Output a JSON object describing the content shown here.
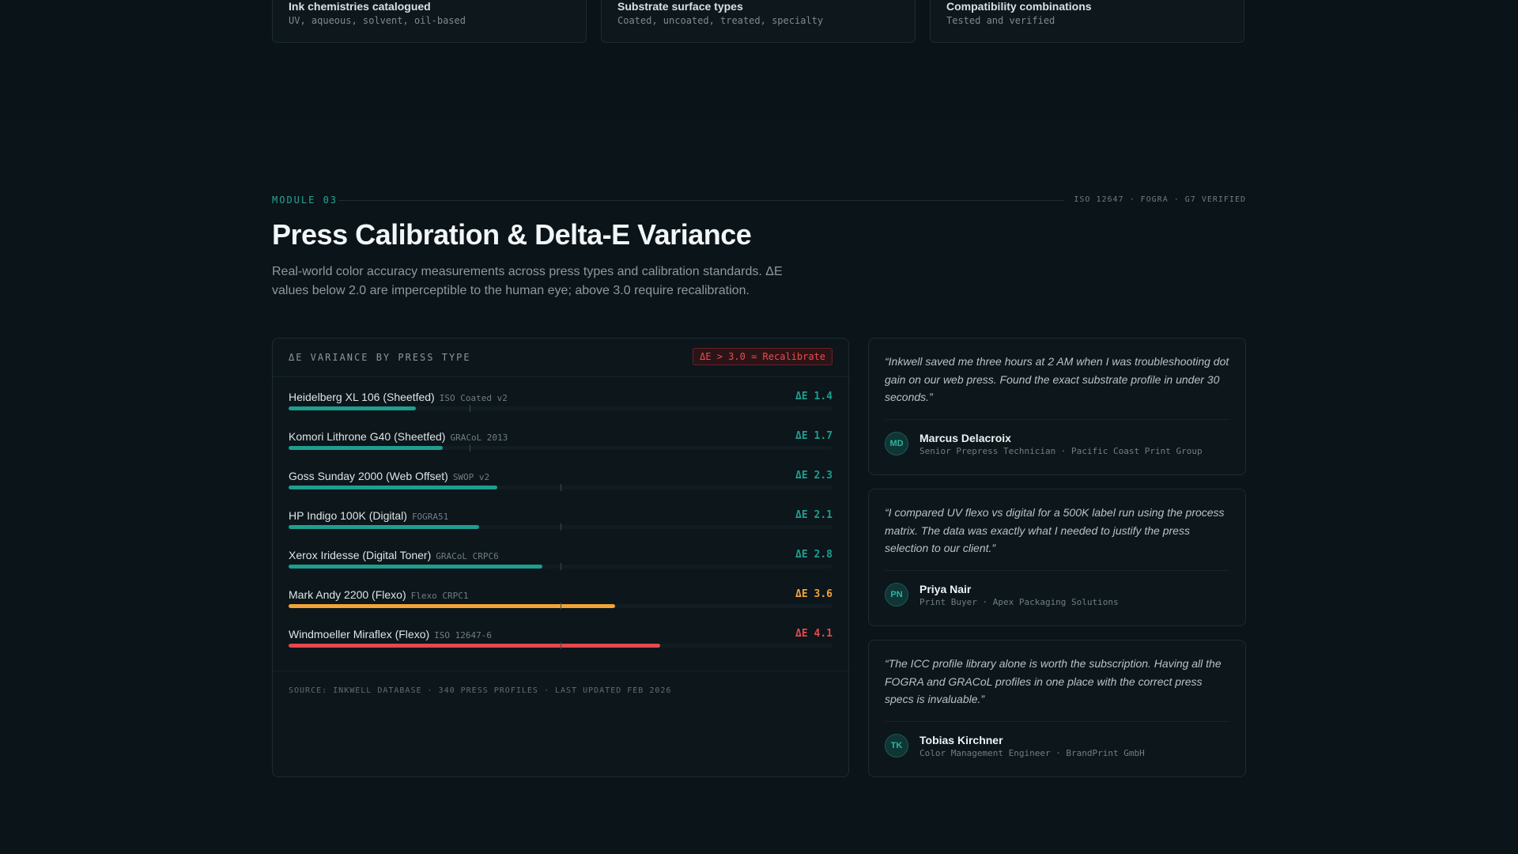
{
  "stats": [
    {
      "label": "Ink chemistries catalogued",
      "sub": "UV, aqueous, solvent, oil-based"
    },
    {
      "label": "Substrate surface types",
      "sub": "Coated, uncoated, treated, specialty"
    },
    {
      "label": "Compatibility combinations",
      "sub": "Tested and verified"
    }
  ],
  "module": {
    "label": "MODULE 03",
    "meta": "ISO 12647 · FOGRA · G7 VERIFIED",
    "title": "Press Calibration & Delta-E Variance",
    "description": "Real-world color accuracy measurements across press types and calibration standards. ΔE values below 2.0 are imperceptible to the human eye; above 3.0 require recalibration."
  },
  "chart": {
    "title": "ΔE VARIANCE BY PRESS TYPE",
    "badge": "ΔE > 3.0 = Recalibrate",
    "source": "SOURCE: INKWELL DATABASE · 340 PRESS PROFILES · LAST UPDATED FEB 2026"
  },
  "chart_data": {
    "type": "bar",
    "orientation": "horizontal",
    "xlim": [
      0,
      6.0
    ],
    "categories": [
      "Heidelberg XL 106 (Sheetfed)",
      "Komori Lithrone G40 (Sheetfed)",
      "Goss Sunday 2000 (Web Offset)",
      "HP Indigo 100K (Digital)",
      "Xerox Iridesse (Digital Toner)",
      "Mark Andy 2200 (Flexo)",
      "Windmoeller Miraflex (Flexo)"
    ],
    "standards": [
      "ISO Coated v2",
      "GRACoL 2013",
      "SWOP v2",
      "FOGRA51",
      "GRACoL CRPC6",
      "Flexo CRPC1",
      "ISO 12647-6"
    ],
    "values": [
      1.4,
      1.7,
      2.3,
      2.1,
      2.8,
      3.6,
      4.1
    ],
    "value_labels": [
      "ΔE 1.4",
      "ΔE 1.7",
      "ΔE 2.3",
      "ΔE 2.1",
      "ΔE 2.8",
      "ΔE 3.6",
      "ΔE 4.1"
    ],
    "tolerances": [
      2.0,
      2.0,
      3.0,
      3.0,
      3.0,
      3.0,
      3.0
    ],
    "thresholds": {
      "ok": 3.0,
      "recalibrate": 4.0
    },
    "colors": {
      "ok": "#1e9e8f",
      "warning": "#f0a43a",
      "critical": "#e5484d"
    }
  },
  "testimonials": [
    {
      "quote": "“Inkwell saved me three hours at 2 AM when I was troubleshooting dot gain on our web press. Found the exact substrate profile in under 30 seconds.”",
      "initials": "MD",
      "name": "Marcus Delacroix",
      "role": "Senior Prepress Technician · Pacific Coast Print Group"
    },
    {
      "quote": "“I compared UV flexo vs digital for a 500K label run using the process matrix. The data was exactly what I needed to justify the press selection to our client.”",
      "initials": "PN",
      "name": "Priya Nair",
      "role": "Print Buyer · Apex Packaging Solutions"
    },
    {
      "quote": "“The ICC profile library alone is worth the subscription. Having all the FOGRA and GRACoL profiles in one place with the correct press specs is invaluable.”",
      "initials": "TK",
      "name": "Tobias Kirchner",
      "role": "Color Management Engineer · BrandPrint GmbH"
    }
  ]
}
